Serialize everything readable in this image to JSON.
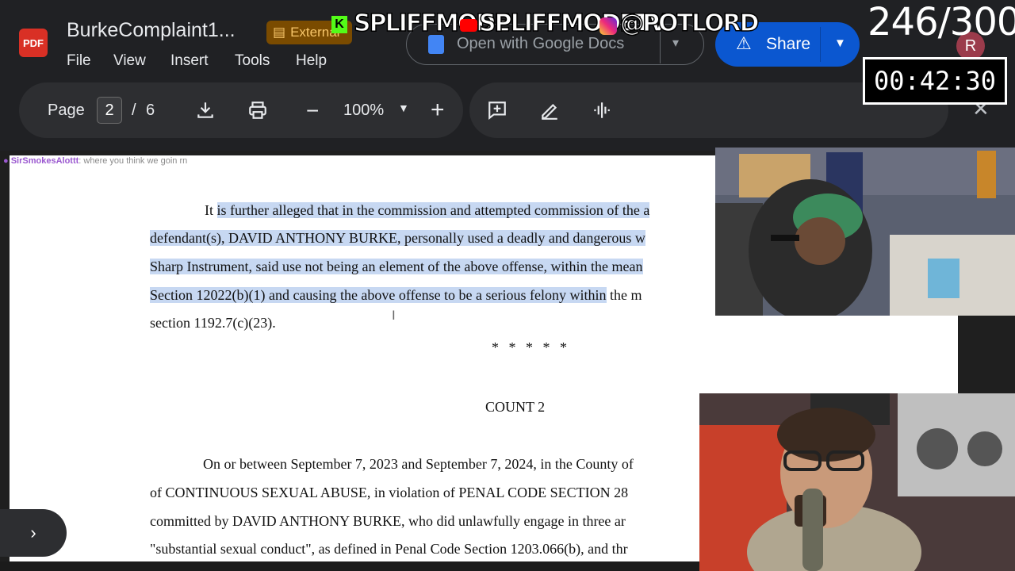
{
  "app": {
    "badge": "PDF",
    "title": "BurkeComplaint1...",
    "external_label": "External"
  },
  "menu": [
    "File",
    "View",
    "Insert",
    "Tools",
    "Help"
  ],
  "open_with": {
    "label": "Open with Google Docs"
  },
  "share": {
    "label": "Share"
  },
  "toolbar": {
    "page_label": "Page",
    "page_current": "2",
    "page_sep": "/",
    "page_total": "6",
    "zoom": "100%",
    "zoom_out": "−",
    "zoom_in": "+"
  },
  "chat": {
    "user": "SirSmokesAlottt",
    "message": ": where you think we goin rn"
  },
  "document": {
    "lines": [
      {
        "pre": "It ",
        "hl": "is further alleged that in the commission and attempted commission of the a",
        "post": ""
      },
      {
        "pre": "",
        "hl": "defendant(s), DAVID ANTHONY BURKE, personally used a deadly and dangerous w",
        "post": ""
      },
      {
        "pre": "",
        "hl": "Sharp Instrument, said use not being an element of the above offense, within the mean",
        "post": ""
      },
      {
        "pre": "",
        "hl": "Section 12022(b)(1) and causing the above offense to be a serious felony within",
        "post": " the m"
      },
      {
        "pre": "section 1192.7(c)(23).",
        "hl": "",
        "post": ""
      }
    ],
    "stars": "* * * * *",
    "count_heading": "COUNT 2",
    "count2_lines": [
      "On or between September 7, 2023 and September 7, 2024, in the County of",
      "of CONTINUOUS SEXUAL ABUSE, in violation of PENAL CODE SECTION 28",
      "committed by DAVID ANTHONY BURKE, who did unlawfully engage in three ar",
      "\"substantial sexual conduct\", as defined in Penal Code Section 1203.066(b), and thr"
    ]
  },
  "overlay": {
    "counter": "246/300",
    "avatar_letter": "R",
    "timer": "00:42:30",
    "social": {
      "kick": "K",
      "handle1": "SPLIFFMODE",
      "handle2": "SPLIFFMODETV",
      "handle3": "@POTLORD"
    }
  },
  "icons": {
    "download": "download-icon",
    "print": "print-icon",
    "comment": "add-comment-icon",
    "annotate": "annotate-icon",
    "more": "more-tools-icon",
    "close": "close-icon",
    "sidebar": "chevron-right-icon"
  }
}
